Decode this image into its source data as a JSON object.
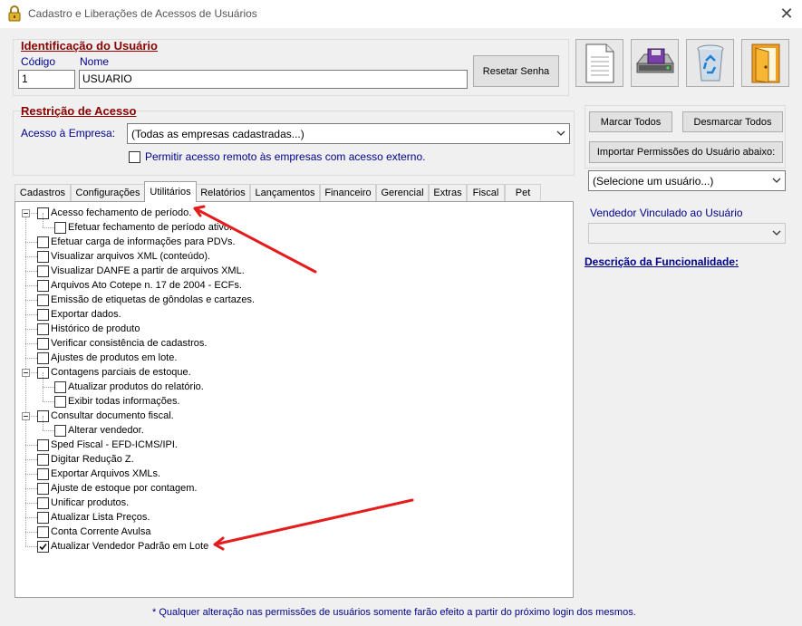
{
  "window": {
    "title": "Cadastro e Liberações de Acessos de Usuários",
    "lock_icon": "lock-icon",
    "close_label": "✕"
  },
  "identification": {
    "title": "Identificação do Usuário",
    "codigo_label": "Código",
    "codigo_value": "1",
    "nome_label": "Nome",
    "nome_value": "USUARIO",
    "reset_button": "Resetar Senha"
  },
  "toolbar": {
    "icons": [
      "new-document-icon",
      "save-disk-icon",
      "recycle-bin-icon",
      "exit-door-icon"
    ]
  },
  "restriction": {
    "title": "Restrição de Acesso",
    "empresa_label": "Acesso à Empresa:",
    "empresa_value": "(Todas as empresas cadastradas...)",
    "remote_label": "Permitir acesso remoto às empresas com acesso externo.",
    "remote_checked": false
  },
  "right_panel": {
    "marcar_todos": "Marcar Todos",
    "desmarcar_todos": "Desmarcar Todos",
    "importar": "Importar Permissões do Usuário abaixo:",
    "user_select": "(Selecione um usuário...)",
    "vendedor_label": "Vendedor Vinculado ao Usuário",
    "vendedor_value": "",
    "descricao_link": "Descrição da Funcionalidade:"
  },
  "tabs": [
    "Cadastros",
    "Configurações",
    "Utilitários",
    "Relatórios",
    "Lançamentos",
    "Financeiro",
    "Gerencial",
    "Extras",
    "Fiscal",
    "Pet"
  ],
  "active_tab": "Utilitários",
  "tree": [
    {
      "label": "Acesso fechamento de período.",
      "level": 0,
      "checked": false,
      "expanded": true
    },
    {
      "label": "Efetuar fechamento de período ativo.",
      "level": 1,
      "checked": false
    },
    {
      "label": "Efetuar carga de informações para PDVs.",
      "level": 0,
      "checked": false
    },
    {
      "label": "Visualizar arquivos XML (conteúdo).",
      "level": 0,
      "checked": false
    },
    {
      "label": "Visualizar DANFE a partir de arquivos XML.",
      "level": 0,
      "checked": false
    },
    {
      "label": "Arquivos Ato Cotepe n. 17 de 2004 - ECFs.",
      "level": 0,
      "checked": false
    },
    {
      "label": "Emissão de etiquetas de gôndolas e cartazes.",
      "level": 0,
      "checked": false
    },
    {
      "label": "Exportar dados.",
      "level": 0,
      "checked": false
    },
    {
      "label": "Histórico de produto",
      "level": 0,
      "checked": false
    },
    {
      "label": "Verificar consistência de cadastros.",
      "level": 0,
      "checked": false
    },
    {
      "label": "Ajustes de produtos em lote.",
      "level": 0,
      "checked": false
    },
    {
      "label": "Contagens parciais de estoque.",
      "level": 0,
      "checked": false,
      "expanded": true
    },
    {
      "label": "Atualizar produtos do relatório.",
      "level": 1,
      "checked": false
    },
    {
      "label": "Exibir todas informações.",
      "level": 1,
      "checked": false
    },
    {
      "label": "Consultar documento fiscal.",
      "level": 0,
      "checked": false,
      "expanded": true
    },
    {
      "label": "Alterar vendedor.",
      "level": 1,
      "checked": false
    },
    {
      "label": "Sped Fiscal - EFD-ICMS/IPI.",
      "level": 0,
      "checked": false
    },
    {
      "label": "Digitar Redução Z.",
      "level": 0,
      "checked": false
    },
    {
      "label": "Exportar Arquivos XMLs.",
      "level": 0,
      "checked": false
    },
    {
      "label": "Ajuste de estoque por contagem.",
      "level": 0,
      "checked": false
    },
    {
      "label": "Unificar produtos.",
      "level": 0,
      "checked": false
    },
    {
      "label": "Atualizar Lista Preços.",
      "level": 0,
      "checked": false
    },
    {
      "label": "Conta Corrente Avulsa",
      "level": 0,
      "checked": false
    },
    {
      "label": "Atualizar Vendedor Padrão em Lote",
      "level": 0,
      "checked": true
    }
  ],
  "footer": {
    "note": "* Qualquer alteração nas permissões de usuários somente farão efeito a partir do próximo login dos mesmos."
  },
  "colors": {
    "group_title": "#8b0000",
    "label_blue": "#00008b",
    "annotation_arrow": "#e51c1c"
  }
}
